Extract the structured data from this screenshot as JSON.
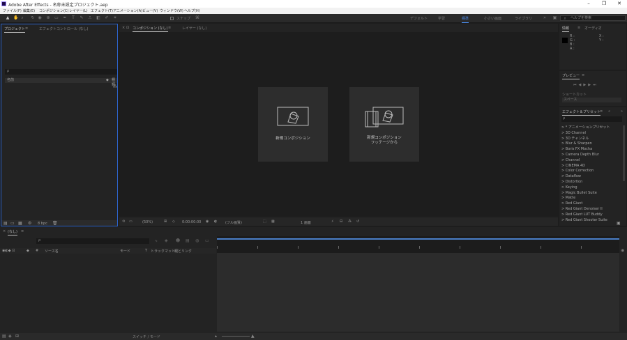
{
  "window": {
    "title": "Adobe After Effects - 名称未設定プロジェクト.aep",
    "controls": [
      "minimize-icon",
      "restore-icon",
      "close-icon"
    ]
  },
  "menubar": {
    "items": [
      "ファイル(F)",
      "編集(E)",
      "コンポジション(C)",
      "レイヤー(L)",
      "エフェクト(T)",
      "アニメーション(A)",
      "ビュー(V)",
      "ウィンドウ(W)",
      "ヘルプ(H)"
    ]
  },
  "toolbar": {
    "snap_label": "スナップ",
    "workspaces": [
      "デフォルト",
      "学習",
      "標準",
      "小さい画面",
      "ライブラリ"
    ],
    "active_workspace": "標準",
    "help_search_placeholder": "ヘルプを検索"
  },
  "project_panel": {
    "tabs": [
      "プロジェクト",
      "エフェクトコントロール (なし)"
    ],
    "search_placeholder": "ρ",
    "column_name": "名前",
    "column_type": "種類",
    "footer_bpc": "8 bpc"
  },
  "composition_panel": {
    "tabs": [
      "コンポジション (なし)",
      "レイヤー (なし)"
    ],
    "tile_new_comp": "新規コンポジション",
    "tile_from_footage": "新規コンポジション\nフッテージから",
    "footer_zoom": "(50%)",
    "footer_timecode": "0:00:00:00",
    "footer_quality": "(フル画質)",
    "footer_view": "1 画面"
  },
  "info_panel": {
    "tabs": [
      "情報",
      "オーディオ"
    ],
    "rgba": [
      "R :",
      "G :",
      "B :",
      "A :"
    ],
    "xy": [
      "X :",
      "Y :"
    ]
  },
  "preview_panel": {
    "title": "プレビュー",
    "shortcut_label": "ショートカット",
    "shortcut_value": "スペース"
  },
  "effects_panel": {
    "title": "エフェクト＆プリセット",
    "search_placeholder": "ρ",
    "items": [
      "* アニメーションプリセット",
      "3D Channel",
      "3D チャンネル",
      "Blur & Sharpen",
      "Boris FX Mocha",
      "Camera Depth Blur",
      "Channel",
      "CINEMA 4D",
      "Color Correction",
      "Dataflow",
      "Distortion",
      "Keying",
      "Magic Bullet Suite",
      "Matte",
      "Red Giant",
      "Red Giant Denoiser II",
      "Red Giant LUT Buddy",
      "Red Giant Shooter Suite"
    ]
  },
  "timeline_panel": {
    "tab": "(なし)",
    "search_placeholder": "ρ",
    "columns": [
      "#",
      "ソース名",
      "モード",
      "T",
      "トラックマット",
      "親とリンク"
    ],
    "footer_label": "スイッチ / モード"
  }
}
